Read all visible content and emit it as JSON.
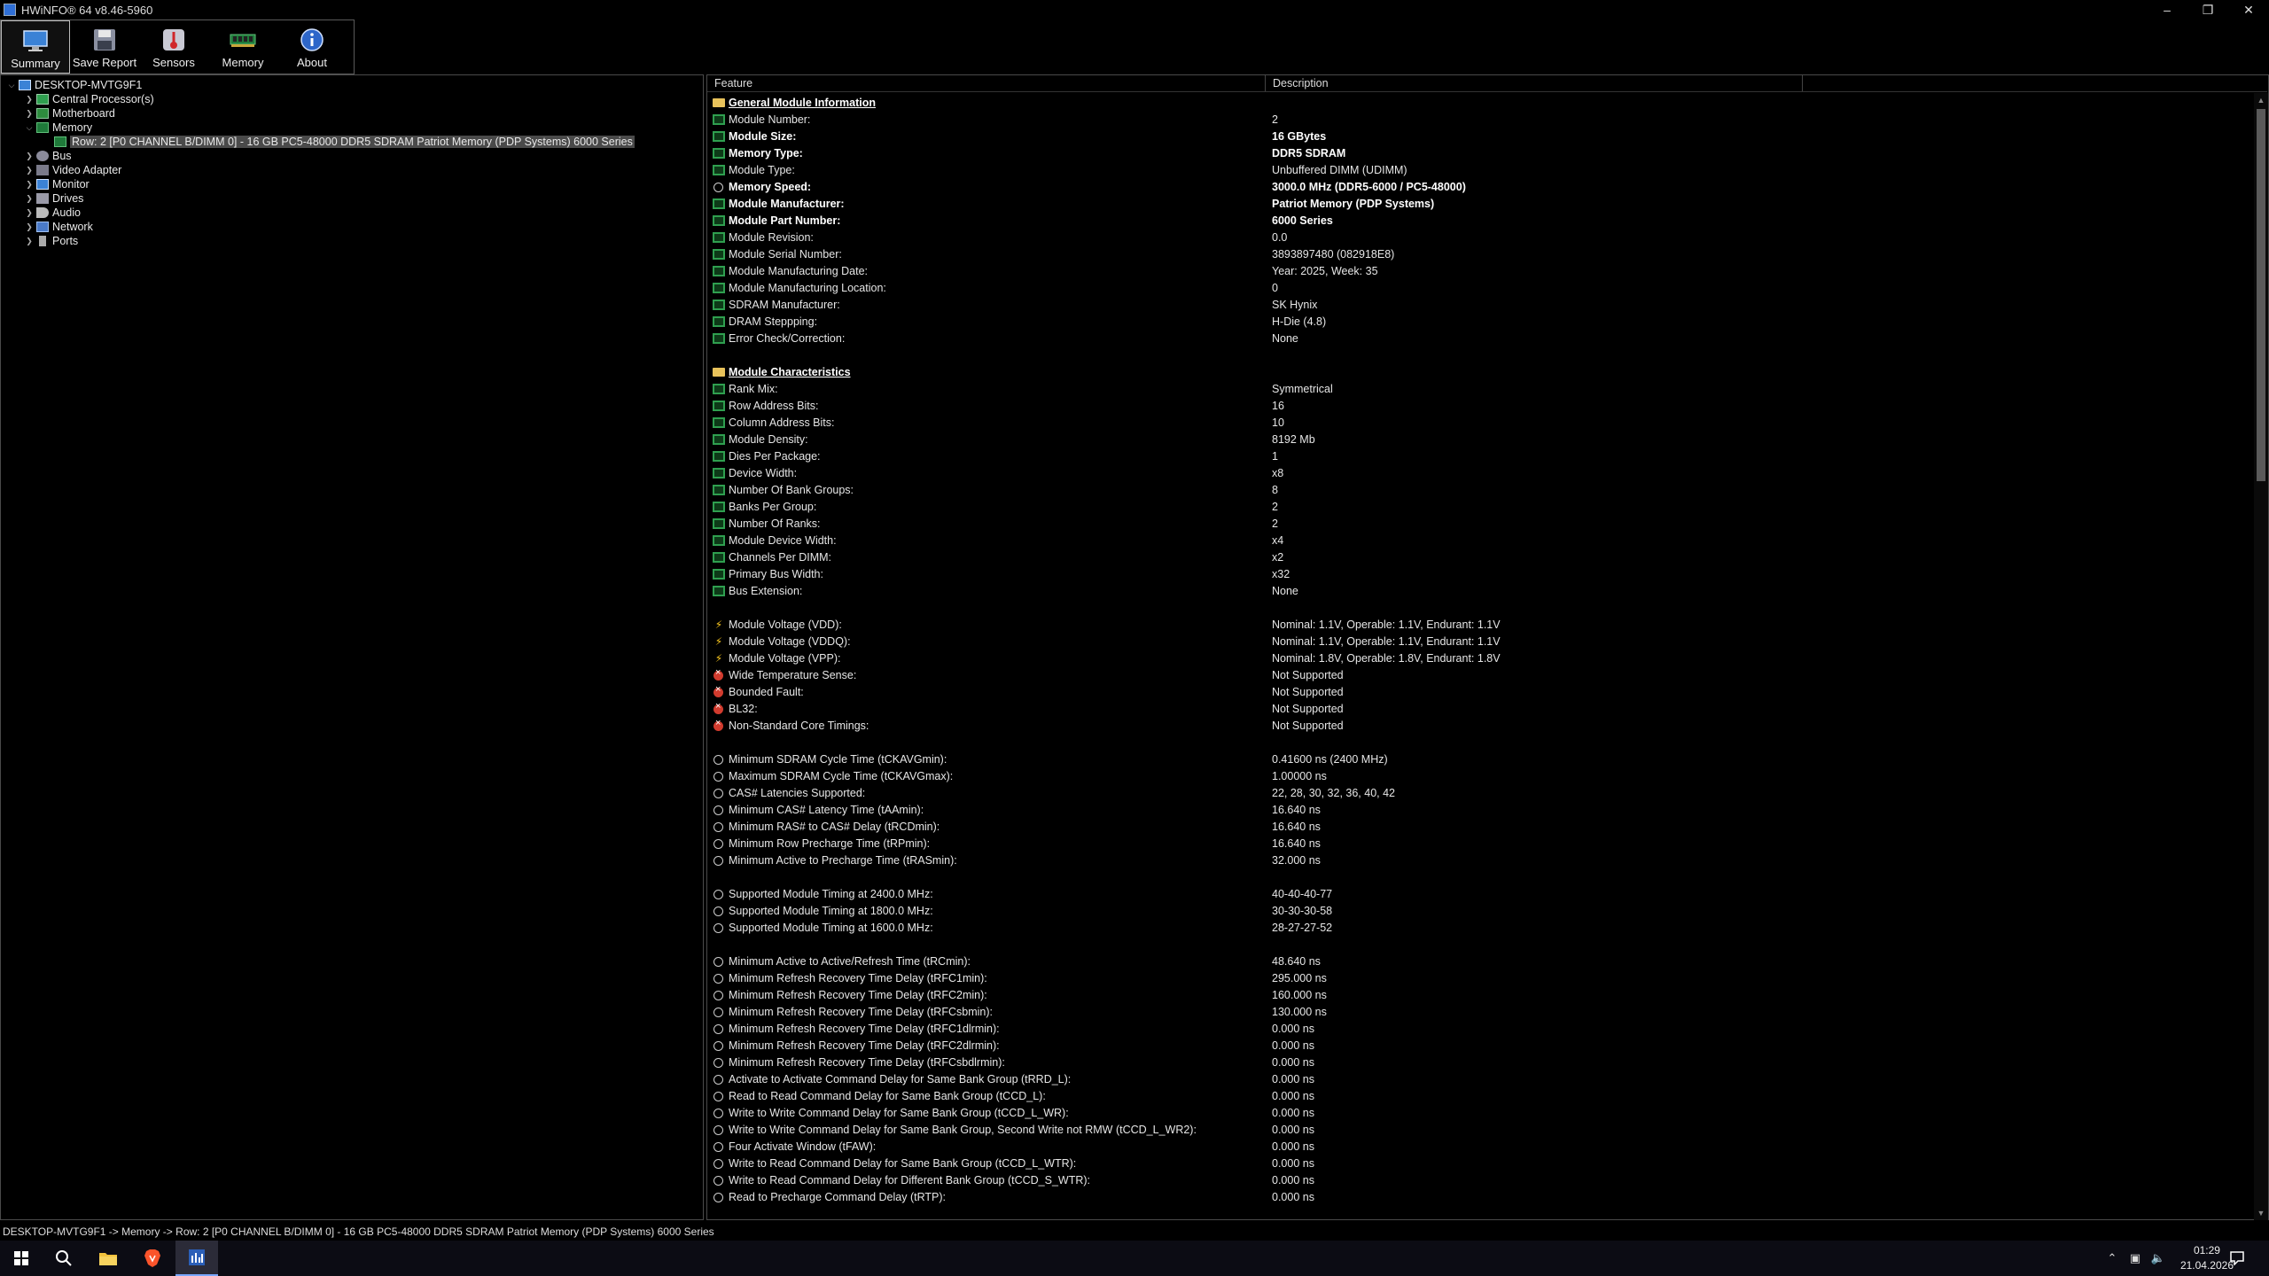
{
  "window": {
    "title": "HWiNFO® 64 v8.46-5960"
  },
  "toolbar": {
    "buttons": [
      {
        "label": "Summary"
      },
      {
        "label": "Save Report"
      },
      {
        "label": "Sensors"
      },
      {
        "label": "Memory"
      },
      {
        "label": "About"
      }
    ]
  },
  "tree": {
    "root": "DESKTOP-MVTG9F1",
    "items": [
      {
        "label": "Central Processor(s)"
      },
      {
        "label": "Motherboard"
      },
      {
        "label": "Memory"
      },
      {
        "label": "Row: 2 [P0 CHANNEL B/DIMM 0] - 16 GB PC5-48000 DDR5 SDRAM Patriot Memory (PDP Systems) 6000 Series"
      },
      {
        "label": "Bus"
      },
      {
        "label": "Video Adapter"
      },
      {
        "label": "Monitor"
      },
      {
        "label": "Drives"
      },
      {
        "label": "Audio"
      },
      {
        "label": "Network"
      },
      {
        "label": "Ports"
      }
    ]
  },
  "list": {
    "headers": {
      "feature": "Feature",
      "description": "Description"
    },
    "rows": [
      {
        "f": "General Module Information",
        "d": "",
        "icon": "folder",
        "style": "sec"
      },
      {
        "f": "Module Number:",
        "d": "2",
        "icon": "mem"
      },
      {
        "f": "Module Size:",
        "d": "16 GBytes",
        "icon": "mem",
        "style": "bold"
      },
      {
        "f": "Memory Type:",
        "d": "DDR5 SDRAM",
        "icon": "mem",
        "style": "bold"
      },
      {
        "f": "Module Type:",
        "d": "Unbuffered DIMM (UDIMM)",
        "icon": "mem"
      },
      {
        "f": "Memory Speed:",
        "d": "3000.0 MHz (DDR5-6000 / PC5-48000)",
        "icon": "clock",
        "style": "bold"
      },
      {
        "f": "Module Manufacturer:",
        "d": "Patriot Memory (PDP Systems)",
        "icon": "mem",
        "style": "bold"
      },
      {
        "f": "Module Part Number:",
        "d": "6000 Series",
        "icon": "mem",
        "style": "bold"
      },
      {
        "f": "Module Revision:",
        "d": "0.0",
        "icon": "mem"
      },
      {
        "f": "Module Serial Number:",
        "d": "3893897480 (082918E8)",
        "icon": "mem"
      },
      {
        "f": "Module Manufacturing Date:",
        "d": "Year: 2025, Week: 35",
        "icon": "mem"
      },
      {
        "f": "Module Manufacturing Location:",
        "d": "0",
        "icon": "mem"
      },
      {
        "f": "SDRAM Manufacturer:",
        "d": "SK Hynix",
        "icon": "mem"
      },
      {
        "f": "DRAM Steppping:",
        "d": "H-Die (4.8)",
        "icon": "mem"
      },
      {
        "f": "Error Check/Correction:",
        "d": "None",
        "icon": "mem"
      },
      {
        "f": "",
        "d": "",
        "icon": "none"
      },
      {
        "f": "Module Characteristics",
        "d": "",
        "icon": "folder",
        "style": "sec"
      },
      {
        "f": "Rank Mix:",
        "d": "Symmetrical",
        "icon": "mem"
      },
      {
        "f": "Row Address Bits:",
        "d": "16",
        "icon": "mem"
      },
      {
        "f": "Column Address Bits:",
        "d": "10",
        "icon": "mem"
      },
      {
        "f": "Module Density:",
        "d": "8192 Mb",
        "icon": "mem"
      },
      {
        "f": "Dies Per Package:",
        "d": "1",
        "icon": "mem"
      },
      {
        "f": "Device Width:",
        "d": "x8",
        "icon": "mem"
      },
      {
        "f": "Number Of Bank Groups:",
        "d": "8",
        "icon": "mem"
      },
      {
        "f": "Banks Per Group:",
        "d": "2",
        "icon": "mem"
      },
      {
        "f": "Number Of Ranks:",
        "d": "2",
        "icon": "mem"
      },
      {
        "f": "Module Device Width:",
        "d": "x4",
        "icon": "mem"
      },
      {
        "f": "Channels Per DIMM:",
        "d": "x2",
        "icon": "mem"
      },
      {
        "f": "Primary Bus Width:",
        "d": "x32",
        "icon": "mem"
      },
      {
        "f": "Bus Extension:",
        "d": "None",
        "icon": "mem"
      },
      {
        "f": "",
        "d": "",
        "icon": "none"
      },
      {
        "f": "Module Voltage (VDD):",
        "d": "Nominal: 1.1V, Operable: 1.1V, Endurant: 1.1V",
        "icon": "bolt"
      },
      {
        "f": "Module Voltage (VDDQ):",
        "d": "Nominal: 1.1V, Operable: 1.1V, Endurant: 1.1V",
        "icon": "bolt"
      },
      {
        "f": "Module Voltage (VPP):",
        "d": "Nominal: 1.8V, Operable: 1.8V, Endurant: 1.8V",
        "icon": "bolt"
      },
      {
        "f": "Wide Temperature Sense:",
        "d": "Not Supported",
        "icon": "x"
      },
      {
        "f": "Bounded Fault:",
        "d": "Not Supported",
        "icon": "x"
      },
      {
        "f": "BL32:",
        "d": "Not Supported",
        "icon": "x"
      },
      {
        "f": "Non-Standard Core Timings:",
        "d": "Not Supported",
        "icon": "x"
      },
      {
        "f": "",
        "d": "",
        "icon": "none"
      },
      {
        "f": "Minimum SDRAM Cycle Time (tCKAVGmin):",
        "d": "0.41600 ns (2400 MHz)",
        "icon": "clock"
      },
      {
        "f": "Maximum SDRAM Cycle Time (tCKAVGmax):",
        "d": "1.00000 ns",
        "icon": "clock"
      },
      {
        "f": "CAS# Latencies Supported:",
        "d": "22, 28, 30, 32, 36, 40, 42",
        "icon": "clock"
      },
      {
        "f": "Minimum CAS# Latency Time (tAAmin):",
        "d": "16.640 ns",
        "icon": "clock"
      },
      {
        "f": "Minimum RAS# to CAS# Delay (tRCDmin):",
        "d": "16.640 ns",
        "icon": "clock"
      },
      {
        "f": "Minimum Row Precharge Time (tRPmin):",
        "d": "16.640 ns",
        "icon": "clock"
      },
      {
        "f": "Minimum Active to Precharge Time (tRASmin):",
        "d": "32.000 ns",
        "icon": "clock"
      },
      {
        "f": "",
        "d": "",
        "icon": "none"
      },
      {
        "f": "Supported Module Timing at 2400.0 MHz:",
        "d": "40-40-40-77",
        "icon": "clock"
      },
      {
        "f": "Supported Module Timing at 1800.0 MHz:",
        "d": "30-30-30-58",
        "icon": "clock"
      },
      {
        "f": "Supported Module Timing at 1600.0 MHz:",
        "d": "28-27-27-52",
        "icon": "clock"
      },
      {
        "f": "",
        "d": "",
        "icon": "none"
      },
      {
        "f": "Minimum Active to Active/Refresh Time (tRCmin):",
        "d": "48.640 ns",
        "icon": "clock"
      },
      {
        "f": "Minimum Refresh Recovery Time Delay (tRFC1min):",
        "d": "295.000 ns",
        "icon": "clock"
      },
      {
        "f": "Minimum Refresh Recovery Time Delay (tRFC2min):",
        "d": "160.000 ns",
        "icon": "clock"
      },
      {
        "f": "Minimum Refresh Recovery Time Delay (tRFCsbmin):",
        "d": "130.000 ns",
        "icon": "clock"
      },
      {
        "f": "Minimum Refresh Recovery Time Delay (tRFC1dlrmin):",
        "d": "0.000 ns",
        "icon": "clock"
      },
      {
        "f": "Minimum Refresh Recovery Time Delay (tRFC2dlrmin):",
        "d": "0.000 ns",
        "icon": "clock"
      },
      {
        "f": "Minimum Refresh Recovery Time Delay (tRFCsbdlrmin):",
        "d": "0.000 ns",
        "icon": "clock"
      },
      {
        "f": "Activate to Activate Command Delay for Same Bank Group (tRRD_L):",
        "d": "0.000 ns",
        "icon": "clock"
      },
      {
        "f": "Read to Read Command Delay for Same Bank Group (tCCD_L):",
        "d": "0.000 ns",
        "icon": "clock"
      },
      {
        "f": "Write to Write Command Delay for Same Bank Group (tCCD_L_WR):",
        "d": "0.000 ns",
        "icon": "clock"
      },
      {
        "f": "Write to Write Command Delay for Same Bank Group, Second Write not RMW (tCCD_L_WR2):",
        "d": "0.000 ns",
        "icon": "clock"
      },
      {
        "f": "Four Activate Window (tFAW):",
        "d": "0.000 ns",
        "icon": "clock"
      },
      {
        "f": "Write to Read Command Delay for Same Bank Group (tCCD_L_WTR):",
        "d": "0.000 ns",
        "icon": "clock"
      },
      {
        "f": "Write to Read Command Delay for Different Bank Group (tCCD_S_WTR):",
        "d": "0.000 ns",
        "icon": "clock"
      },
      {
        "f": "Read to Precharge Command Delay (tRTP):",
        "d": "0.000 ns",
        "icon": "clock"
      }
    ]
  },
  "statusbar": {
    "path": "DESKTOP-MVTG9F1 -> Memory -> Row: 2 [P0 CHANNEL B/DIMM 0] - 16 GB PC5-48000 DDR5 SDRAM Patriot Memory (PDP Systems) 6000 Series"
  },
  "taskbar": {
    "time": "01:29",
    "date": "21.04.2026"
  }
}
